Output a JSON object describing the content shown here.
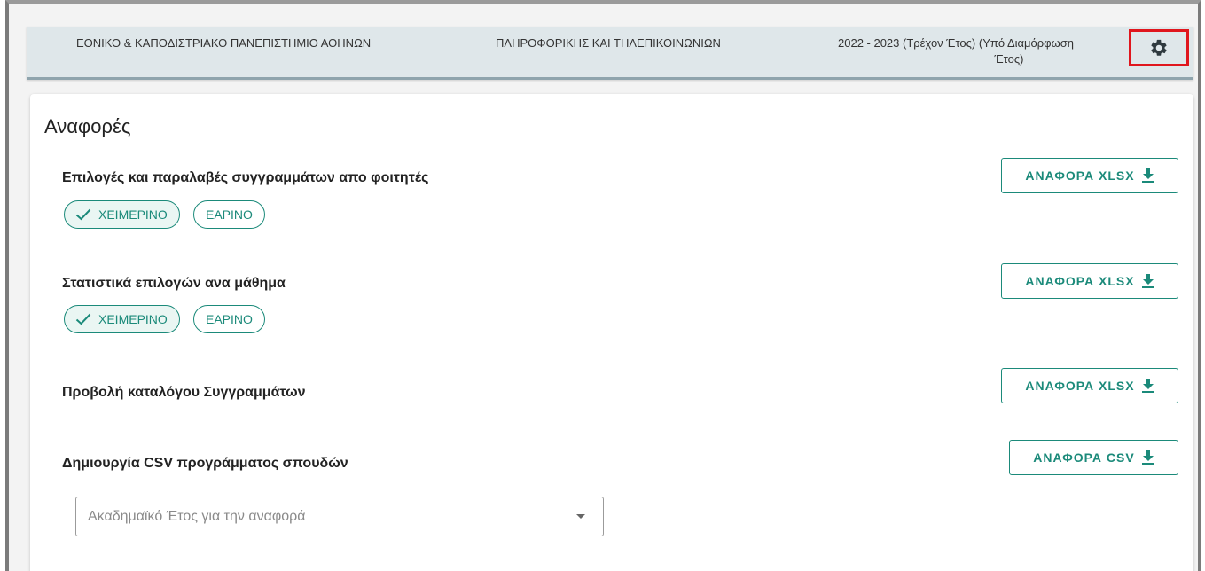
{
  "header": {
    "university": "ΕΘΝΙΚΟ & ΚΑΠΟΔΙΣΤΡΙΑΚΟ ΠΑΝΕΠΙΣΤΗΜΙΟ ΑΘΗΝΩΝ",
    "department": "ΠΛΗΡΟΦΟΡΙΚΗΣ ΚΑΙ ΤΗΛΕΠΙΚΟΙΝΩΝΙΩΝ",
    "year_line1": "2022 - 2023 (Τρέχον Έτος) (Υπό Διαμόρφωση",
    "year_line2": "Έτος)",
    "settings_icon": "gear-icon",
    "highlight_color": "#e0161d"
  },
  "page": {
    "title": "Αναφορές"
  },
  "reports": [
    {
      "title": "Επιλογές και παραλαβές συγγραμμάτων απο φοιτητές",
      "button": "ΑΝΑΦΟΡΑ XLSX",
      "chips": [
        "ΧΕΙΜΕΡΙΝΟ",
        "ΕΑΡΙΝΟ"
      ],
      "selected_chip": "ΧΕΙΜΕΡΙΝΟ"
    },
    {
      "title": "Στατιστικά επιλογών ανα μάθημα",
      "button": "ΑΝΑΦΟΡΑ XLSX",
      "chips": [
        "ΧΕΙΜΕΡΙΝΟ",
        "ΕΑΡΙΝΟ"
      ],
      "selected_chip": "ΧΕΙΜΕΡΙΝΟ"
    },
    {
      "title": "Προβολή καταλόγου Συγγραμμάτων",
      "button": "ΑΝΑΦΟΡΑ XLSX"
    },
    {
      "title": "Δημιουργία CSV προγράμματος σπουδών",
      "button": "ΑΝΑΦΟΡΑ CSV",
      "select_placeholder": "Ακαδημαϊκό Έτος για την αναφορά"
    }
  ],
  "colors": {
    "accent": "#1b8a7a",
    "header_bg": "#dfe7ea"
  }
}
